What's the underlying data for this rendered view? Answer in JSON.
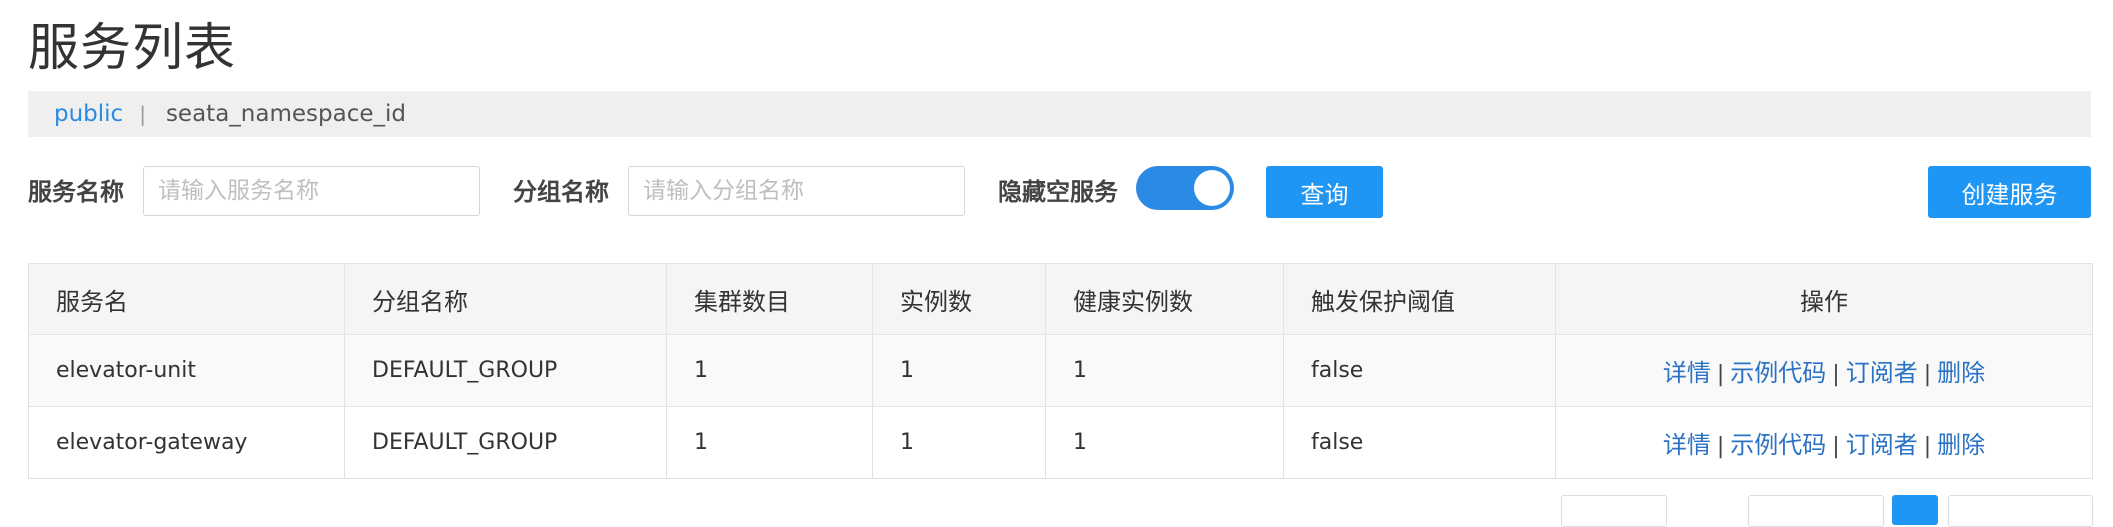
{
  "page": {
    "title": "服务列表"
  },
  "namespaces": [
    {
      "label": "public",
      "active": true
    },
    {
      "label": "seata_namespace_id",
      "active": false
    }
  ],
  "namespace_separator": "|",
  "search": {
    "service_name_label": "服务名称",
    "service_name_placeholder": "请输入服务名称",
    "group_name_label": "分组名称",
    "group_name_placeholder": "请输入分组名称",
    "hide_empty_label": "隐藏空服务",
    "hide_empty_on": true,
    "query_button": "查询",
    "create_button": "创建服务"
  },
  "table": {
    "headers": [
      "服务名",
      "分组名称",
      "集群数目",
      "实例数",
      "健康实例数",
      "触发保护阈值",
      "操作"
    ],
    "rows": [
      {
        "name": "elevator-unit",
        "group": "DEFAULT_GROUP",
        "clusters": "1",
        "instances": "1",
        "healthy": "1",
        "threshold": "false"
      },
      {
        "name": "elevator-gateway",
        "group": "DEFAULT_GROUP",
        "clusters": "1",
        "instances": "1",
        "healthy": "1",
        "threshold": "false"
      }
    ],
    "actions": {
      "detail": "详情",
      "sample_code": "示例代码",
      "subscribers": "订阅者",
      "delete": "删除",
      "separator": "|"
    }
  },
  "colors": {
    "accent": "#1f96f3",
    "link": "#2b72c4",
    "namespace_active": "#2b8ae4"
  }
}
